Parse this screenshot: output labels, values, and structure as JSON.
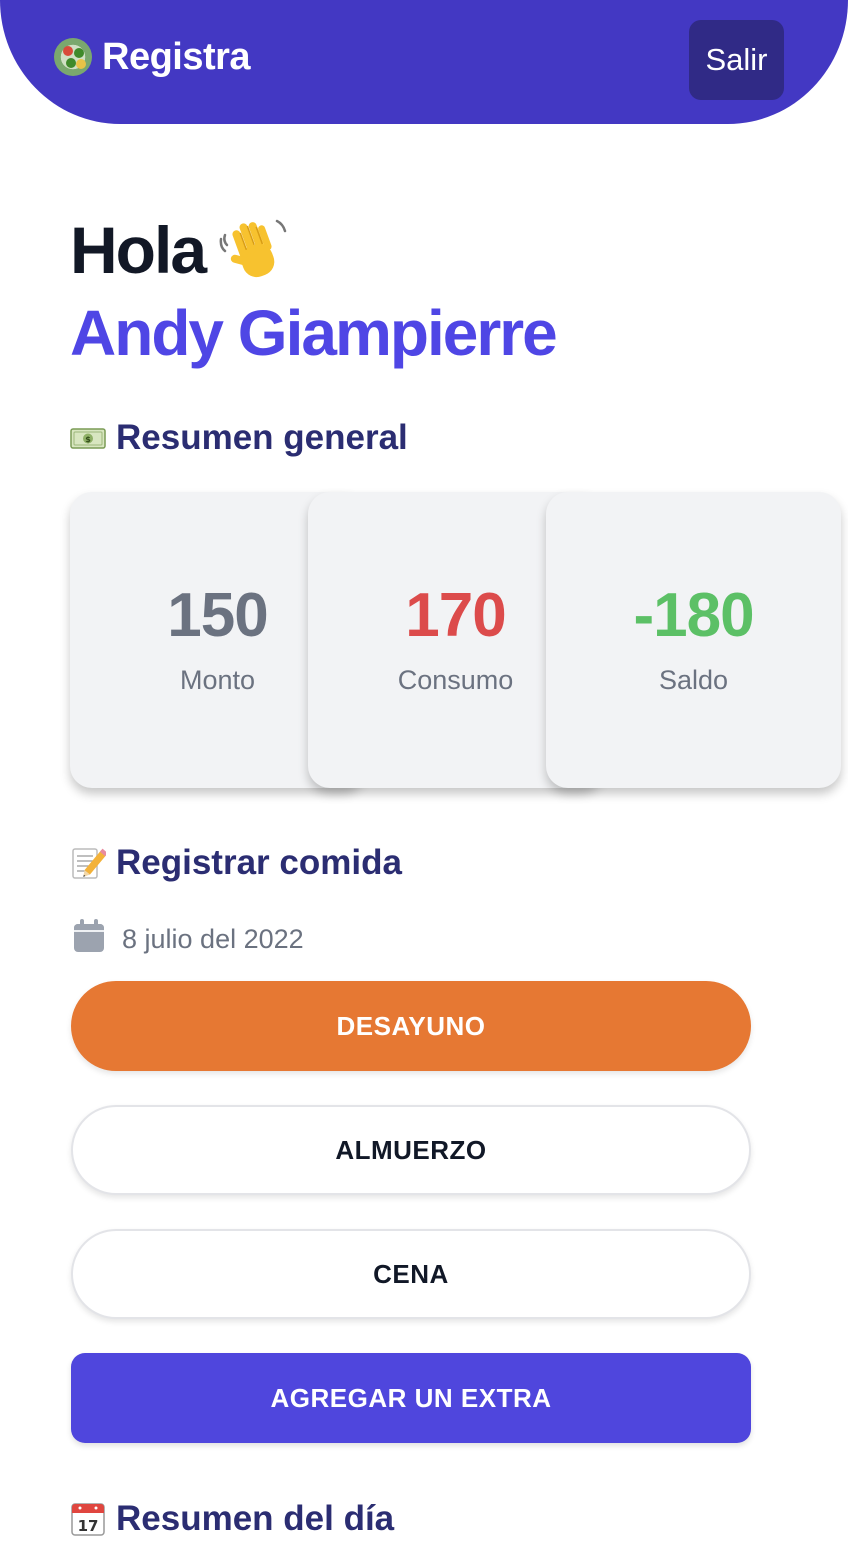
{
  "header": {
    "brand_name": "Registra",
    "brand_icon": "salad-bowl-icon",
    "logout_label": "Salir",
    "colors": {
      "header_bg": "#4338c3",
      "logout_bg": "#302a86"
    }
  },
  "greeting": {
    "hello": "Hola",
    "hello_icon": "waving-hand-icon",
    "user_name": "Andy Giampierre"
  },
  "summary": {
    "title": "Resumen general",
    "icon": "money-icon",
    "cards": [
      {
        "value": "150",
        "label": "Monto",
        "color": "#6b7280"
      },
      {
        "value": "170",
        "label": "Consumo",
        "color": "#dc4b4b"
      },
      {
        "value": "-180",
        "label": "Saldo",
        "color": "#5cc066"
      }
    ]
  },
  "register": {
    "title": "Registrar comida",
    "icon": "memo-icon",
    "date_icon": "calendar-icon",
    "date": "8 julio del 2022",
    "meals": [
      {
        "label": "DESAYUNO",
        "selected": true
      },
      {
        "label": "ALMUERZO",
        "selected": false
      },
      {
        "label": "CENA",
        "selected": false
      }
    ],
    "extra_label": "AGREGAR UN EXTRA",
    "colors": {
      "selected": "#e67833",
      "extra": "#4f46dd"
    }
  },
  "day_summary": {
    "title": "Resumen del día",
    "icon": "calendar-date-icon"
  }
}
